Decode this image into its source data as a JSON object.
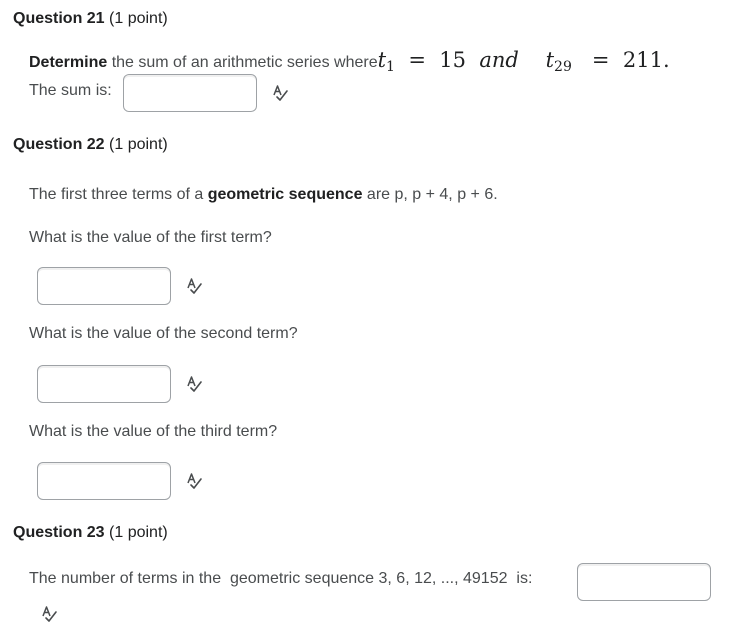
{
  "q21": {
    "title_bold": "Question 21",
    "title_rest": " (1 point)",
    "prompt_bold": "Determine",
    "prompt_rest": " the sum of an arithmetic series where",
    "math_t": "t",
    "math_sub1": "1",
    "math_eq1": "=",
    "math_15": "15",
    "math_and": "and",
    "math_t2": "t",
    "math_sub29": "29",
    "math_eq2": "=",
    "math_211": "211.",
    "sum_label": "The sum is:",
    "sum_value": ""
  },
  "q22": {
    "title_bold": "Question 22",
    "title_rest": " (1 point)",
    "intro_pre": "The first three terms of a ",
    "intro_bold": "geometric sequence",
    "intro_post": " are p, p + 4, p + 6.",
    "first_label": "What is the value of the first term?",
    "second_label": "What is the value of the second term?",
    "third_label": "What is the value of the third term?",
    "first_value": "",
    "second_value": "",
    "third_value": ""
  },
  "q23": {
    "title_bold": "Question 23",
    "title_rest": " (1 point)",
    "prompt": "The number of terms in the  geometric sequence 3, 6, 12, ..., 49152  is:",
    "answer_value": ""
  },
  "icons": {
    "spellcheck": "spellcheck-icon"
  }
}
